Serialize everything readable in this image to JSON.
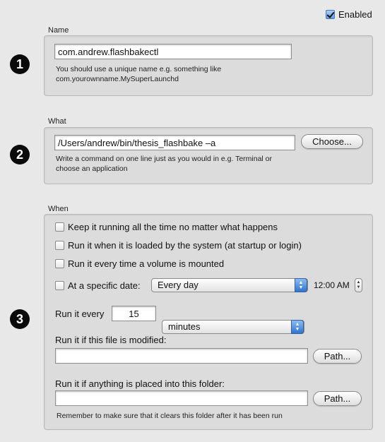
{
  "enabled": {
    "label": "Enabled",
    "checked": true
  },
  "name_section": {
    "title": "Name",
    "step": "1",
    "value": "com.andrew.flashbakectl",
    "hint_line1": "You should use a unique name e.g. something like",
    "hint_line2": "com.yourownname.MySuperLaunchd"
  },
  "what_section": {
    "title": "What",
    "step": "2",
    "value": "/Users/andrew/bin/thesis_flashbake –a",
    "choose_label": "Choose...",
    "hint_line1": "Write a command on one line just as you would in e.g. Terminal or",
    "hint_line2": "choose an application"
  },
  "when_section": {
    "title": "When",
    "step": "3",
    "options": [
      {
        "label": "Keep it running all the time no matter what happens",
        "checked": false
      },
      {
        "label": "Run it when it is loaded by the system (at startup or login)",
        "checked": false
      },
      {
        "label": "Run it every time a volume is mounted",
        "checked": false
      },
      {
        "label": "At a specific date:",
        "checked": false
      }
    ],
    "date_select": "Every day",
    "time_value": "12:00 AM",
    "run_every_label": "Run it every",
    "run_every_value": "15",
    "interval_select": "minutes",
    "file_modified_label": "Run it if this file is modified:",
    "file_modified_value": "",
    "path_label_1": "Path...",
    "folder_label": "Run it if anything is placed into this folder:",
    "folder_value": "",
    "path_label_2": "Path...",
    "folder_hint": "Remember to make sure that it clears this folder after it has been run"
  }
}
